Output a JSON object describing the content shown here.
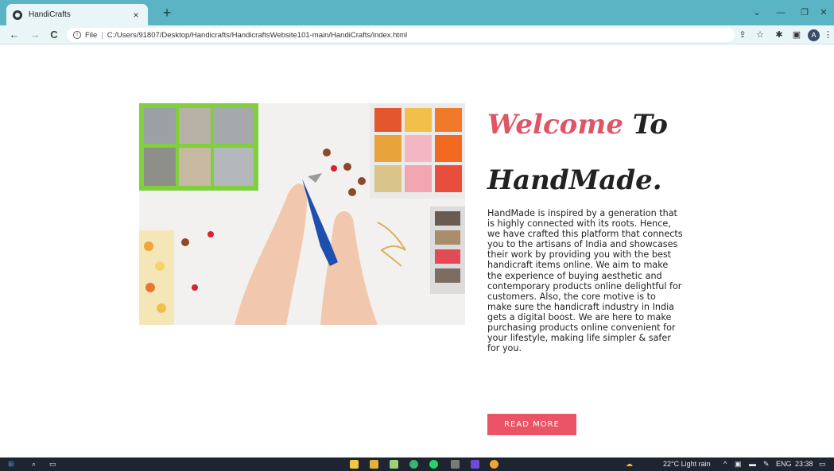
{
  "browser": {
    "tab_title": "HandiCrafts",
    "tab_close": "×",
    "new_tab": "+",
    "window_controls": [
      "⌄",
      "—",
      "❐",
      "✕"
    ],
    "nav": {
      "back": "←",
      "forward": "→",
      "reload": "C"
    },
    "address": {
      "scheme_label": "File",
      "path": "C:/Users/91807/Desktop/Handicrafts/HandicraftsWebsite101-main/HandiCrafts/index.html"
    },
    "profile_initial": "A"
  },
  "hero": {
    "heading_accent": "Welcome",
    "heading_rest": " To",
    "heading_line2": "HandMade.",
    "description": "HandMade is inspired by a generation that is highly connected with its roots. Hence, we have crafted this platform that connects you to the artisans of India and showcases their work by providing you with the best handicraft items online. We aim to make the experience of buying aesthetic and contemporary products online delightful for customers. Also, the core motive is to make sure the handicraft industry in India gets a digital boost. We are here to make purchasing products online convenient for your lifestyle, making life simpler & safer for you.",
    "button_label": "READ MORE",
    "accent_color": "#ea5466"
  },
  "taskbar": {
    "weather": "22°C  Light rain",
    "language": "ENG",
    "time": "23:38"
  }
}
